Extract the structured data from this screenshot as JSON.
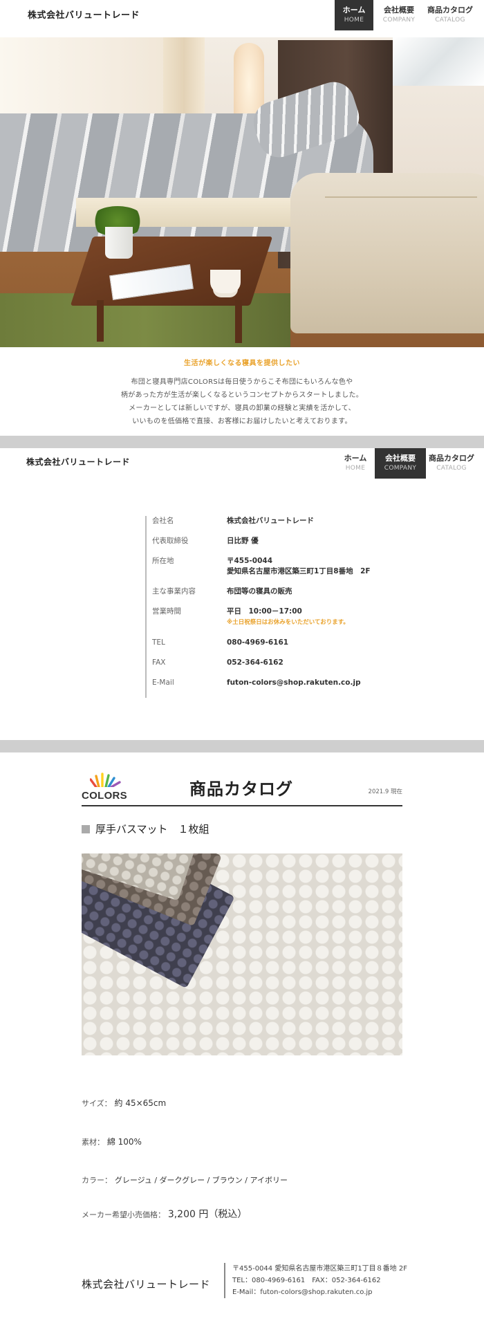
{
  "header": {
    "brand": "株式会社バリュートレード",
    "nav": [
      {
        "jp": "ホーム",
        "en": "HOME"
      },
      {
        "jp": "会社概要",
        "en": "COMPANY"
      },
      {
        "jp": "商品カタログ",
        "en": "CATALOG"
      }
    ]
  },
  "intro": {
    "tagline": "生活が楽しくなる寝具を提供したい",
    "lines": [
      "布団と寝具専門店COLORSは毎日使うからこそ布団にもいろんな色や",
      "柄があった方が生活が楽しくなるというコンセプトからスタートしました。",
      "メーカーとしては新しいですが、寝具の卸業の経験と実績を活かして、",
      "いいものを低価格で直接、お客様にお届けしたいと考えております。"
    ]
  },
  "company": {
    "rows": [
      {
        "k": "会社名",
        "v": "株式会社バリュートレード"
      },
      {
        "k": "代表取締役",
        "v": "日比野 優"
      },
      {
        "k": "所在地",
        "v": "〒455-0044",
        "v2": "愛知県名古屋市港区築三町1丁目8番地　2F"
      },
      {
        "k": "主な事業内容",
        "v": "布団等の寝具の販売"
      },
      {
        "k": "営業時間",
        "v": "平日　10:00－17:00",
        "note": "※土日祝祭日はお休みをいただいております。"
      },
      {
        "k": "TEL",
        "v": "080-4969-6161"
      },
      {
        "k": "FAX",
        "v": "052-364-6162"
      },
      {
        "k": "E-Mail",
        "v": "futon-colors@shop.rakuten.co.jp"
      }
    ]
  },
  "catalog": {
    "logo": "COLORS",
    "title": "商品カタログ",
    "date": "2021.9 現在",
    "product_title": "厚手バスマット　１枚組",
    "size_label": "サイズ：",
    "size": "約 45×65cm",
    "material_label": "素材：",
    "material": "綿 100%",
    "color_label": "カラー：",
    "colors": "グレージュ / ダークグレー / ブラウン / アイボリー",
    "price_label": "メーカー希望小売価格：",
    "price": "3,200 円（税込）"
  },
  "footer": {
    "brand": "株式会社バリュートレード",
    "address": "〒455-0044 愛知県名古屋市港区築三町1丁目８番地 2F",
    "tel_fax": "TEL：080-4969-6161　FAX：052-364-6162",
    "email": "E-Mail：futon-colors@shop.rakuten.co.jp"
  },
  "colors": {
    "accent": "#e9a22b",
    "active_nav": "#333333",
    "band": "#cfcfcf"
  }
}
